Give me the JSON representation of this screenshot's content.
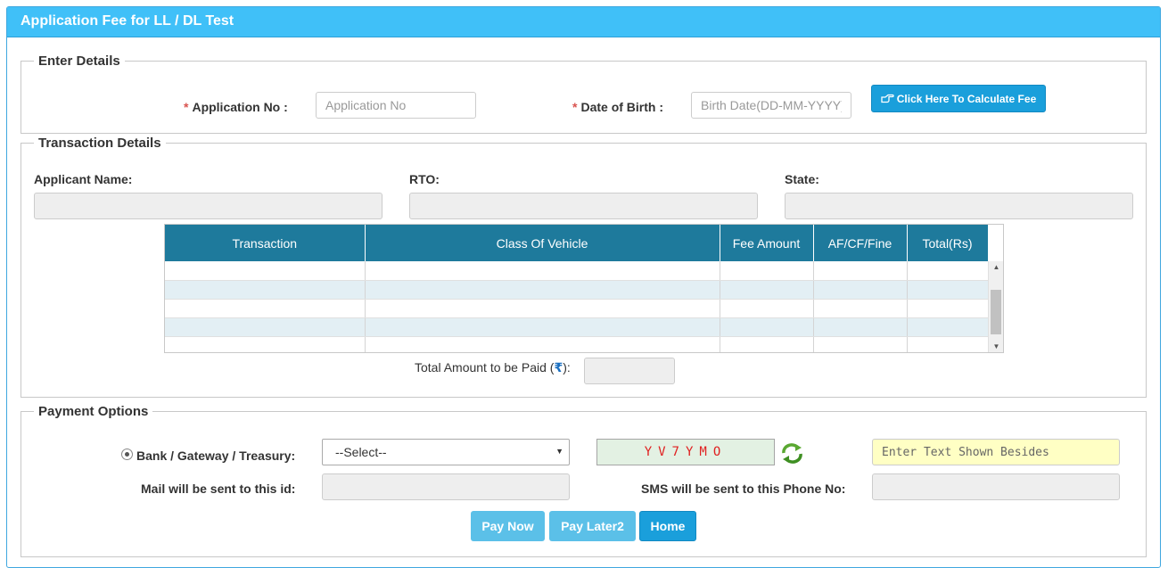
{
  "panel": {
    "title": "Application Fee for LL / DL Test"
  },
  "enter_details": {
    "legend": "Enter Details",
    "application_no_label": "Application No :",
    "application_no_placeholder": "Application No",
    "application_no_value": "",
    "dob_label": "Date of Birth :",
    "dob_placeholder": "Birth Date(DD-MM-YYYY)",
    "dob_value": "",
    "calculate_button": "Click Here To Calculate Fee",
    "required_mark": "*"
  },
  "transaction_details": {
    "legend": "Transaction Details",
    "applicant_name_label": "Applicant Name:",
    "rto_label": "RTO:",
    "state_label": "State:",
    "table": {
      "headers": [
        "Transaction",
        "Class Of Vehicle",
        "Fee Amount",
        "AF/CF/Fine",
        "Total(Rs)"
      ],
      "rows": [
        [
          "",
          "",
          "",
          "",
          ""
        ],
        [
          "",
          "",
          "",
          "",
          ""
        ],
        [
          "",
          "",
          "",
          "",
          ""
        ],
        [
          "",
          "",
          "",
          "",
          ""
        ],
        [
          "",
          "",
          "",
          "",
          ""
        ]
      ]
    },
    "total_label": "Total Amount to be Paid (",
    "total_currency_symbol": "₹",
    "total_label_suffix": "):",
    "total_value": ""
  },
  "payment_options": {
    "legend": "Payment Options",
    "gateway_label": "Bank / Gateway / Treasury:",
    "gateway_selected": "--Select--",
    "captcha_code": "YV7YMO",
    "captcha_placeholder": "Enter Text Shown Besides",
    "mail_label": "Mail will be sent to this id:",
    "sms_label": "SMS will be sent to this Phone No:",
    "buttons": {
      "pay_now": "Pay Now",
      "pay_later": "Pay Later2",
      "home": "Home"
    }
  },
  "colors": {
    "header_bg": "#40c0f8",
    "table_header_bg": "#1e7a9c",
    "primary_button": "#1a9fdb",
    "disabled_button": "#5bc0e8",
    "required": "#d9534f",
    "captcha_text": "#e02020"
  },
  "icons": {
    "calculate": "hand-pointer-icon",
    "refresh": "refresh-icon",
    "rupee": "rupee-icon"
  }
}
